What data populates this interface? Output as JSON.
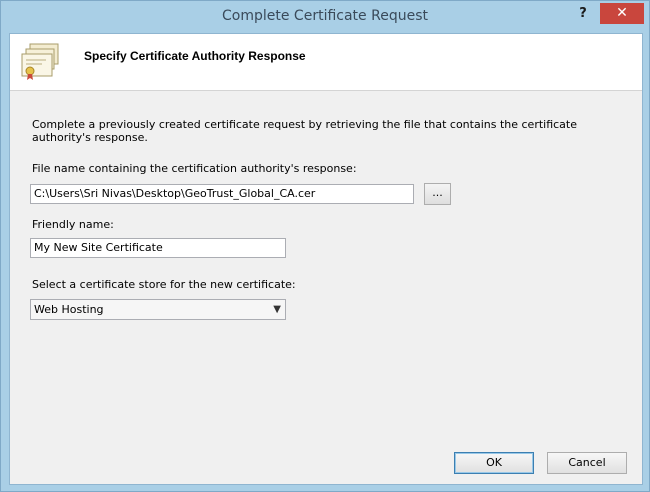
{
  "window": {
    "title": "Complete Certificate Request",
    "help_glyph": "?",
    "close_glyph": "✕"
  },
  "header": {
    "title": "Specify Certificate Authority Response",
    "icon": "certificate-icon"
  },
  "description": "Complete a previously created certificate request by retrieving the file that contains the certificate authority's response.",
  "file_field": {
    "label": "File name containing the certification authority's response:",
    "value": "C:\\Users\\Sri Nivas\\Desktop\\GeoTrust_Global_CA.cer",
    "browse_label": "..."
  },
  "friendly_name": {
    "label": "Friendly name:",
    "value": "My New Site Certificate"
  },
  "store": {
    "label": "Select a certificate store for the new certificate:",
    "selected": "Web Hosting"
  },
  "buttons": {
    "ok": "OK",
    "cancel": "Cancel"
  }
}
